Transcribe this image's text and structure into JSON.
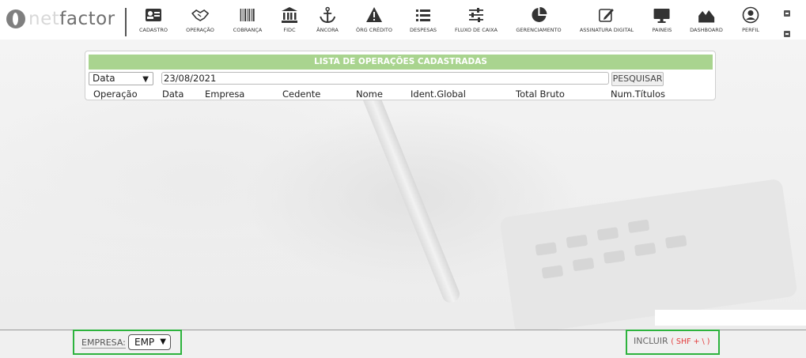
{
  "brand": {
    "logo_main": "net",
    "logo_second": "factor"
  },
  "nav": [
    {
      "label": "CADASTRO",
      "icon": "id-card-icon"
    },
    {
      "label": "OPERAÇÃO",
      "icon": "handshake-icon"
    },
    {
      "label": "COBRANÇA",
      "icon": "barcode-icon"
    },
    {
      "label": "FIDC",
      "icon": "bank-icon"
    },
    {
      "label": "ÂNCORA",
      "icon": "anchor-icon"
    },
    {
      "label": "ÓRG CRÉDITO",
      "icon": "warning-icon"
    },
    {
      "label": "DESPESAS",
      "icon": "list-icon"
    },
    {
      "label": "FLUXO DE CAIXA",
      "icon": "sliders-icon"
    },
    {
      "label": "GERENCIAMENTO",
      "icon": "pie-chart-icon"
    },
    {
      "label": "ASSINATURA DIGITAL",
      "icon": "signature-icon"
    },
    {
      "label": "PAINEIS",
      "icon": "monitor-icon"
    },
    {
      "label": "DASHBOARD",
      "icon": "area-chart-icon"
    },
    {
      "label": "PERFIL",
      "icon": "user-circle-icon"
    }
  ],
  "panel": {
    "title": "LISTA DE OPERAÇÕES CADASTRADAS",
    "filter_field": "Data",
    "date_value": "23/08/2021",
    "search_label": "PESQUISAR",
    "columns": [
      "Operação",
      "Data",
      "Empresa",
      "Cedente",
      "Nome",
      "Ident.Global",
      "Total Bruto",
      "Num.Títulos"
    ]
  },
  "footer": {
    "empresa_label": "EMPRESA:",
    "empresa_value": "EMP",
    "incluir_label": "INCLUIR",
    "incluir_shortcut": "( SHF + \\ )"
  },
  "colors": {
    "title_bar": "#a9d48f",
    "highlight_border": "#2db33d",
    "shortcut": "#e23b3b"
  }
}
